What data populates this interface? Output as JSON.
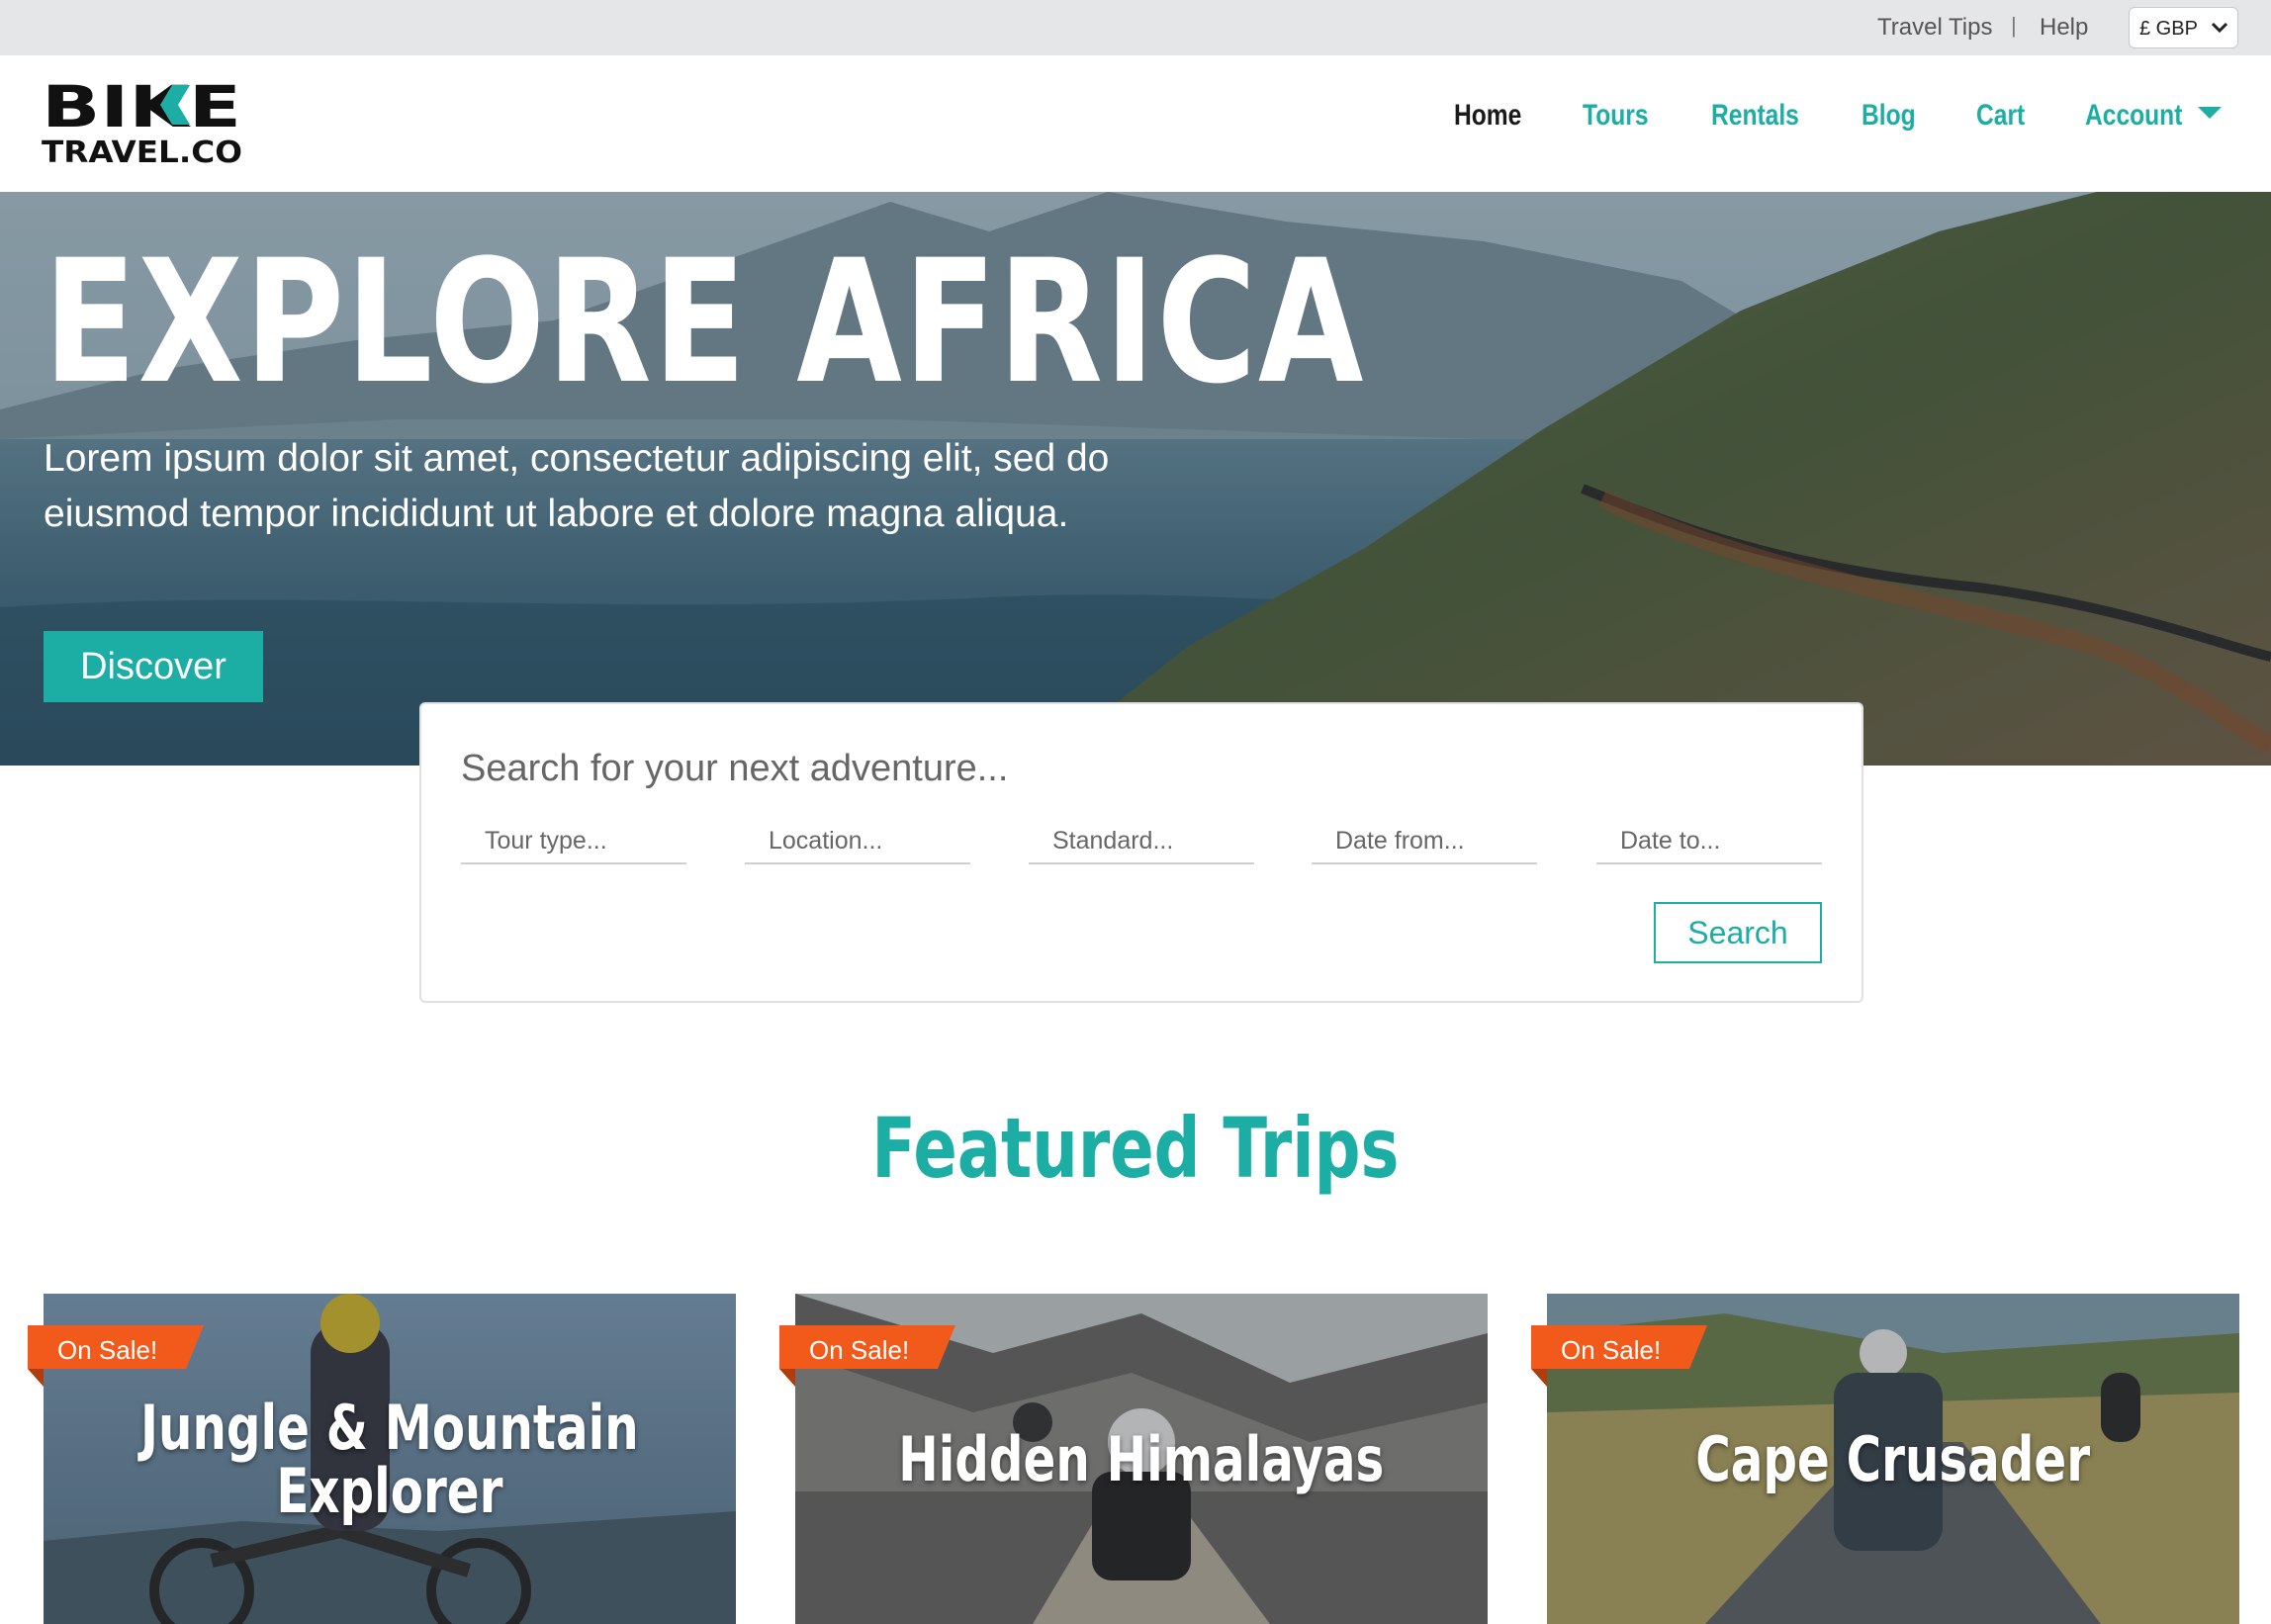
{
  "topbar": {
    "travel_tips": "Travel Tips",
    "separator": "|",
    "help": "Help",
    "currency": "£ GBP",
    "currency_icon": "chevron-down-icon"
  },
  "logo": {
    "line1": "BIKE",
    "line2": "TRAVEL.CO"
  },
  "nav": {
    "items": [
      {
        "label": "Home",
        "active": true
      },
      {
        "label": "Tours",
        "active": false
      },
      {
        "label": "Rentals",
        "active": false
      },
      {
        "label": "Blog",
        "active": false
      },
      {
        "label": "Cart",
        "active": false
      },
      {
        "label": "Account",
        "active": false
      }
    ],
    "account_icon": "caret-down-icon"
  },
  "hero": {
    "title": "EXPLORE AFRICA",
    "text": "Lorem ipsum dolor sit amet, consectetur adipiscing elit, sed do eiusmod tempor incididunt ut labore et dolore magna aliqua.",
    "cta": "Discover"
  },
  "search": {
    "heading": "Search for your next adventure...",
    "fields": [
      {
        "placeholder": "Tour type..."
      },
      {
        "placeholder": "Location..."
      },
      {
        "placeholder": "Standard..."
      },
      {
        "placeholder": "Date from..."
      },
      {
        "placeholder": "Date to..."
      }
    ],
    "button": "Search"
  },
  "featured": {
    "title": "Featured Trips",
    "cards": [
      {
        "title_line1": "Jungle & Mountain",
        "title_line2": "Explorer",
        "badge": "On Sale!"
      },
      {
        "title_line1": "Hidden Himalayas",
        "title_line2": "",
        "badge": "On Sale!"
      },
      {
        "title_line1": "Cape Crusader",
        "title_line2": "",
        "badge": "On Sale!"
      }
    ]
  },
  "colors": {
    "accent": "#1cada4",
    "badge": "#f25a1c",
    "topbar": "#e5e6e8",
    "dark": "#1a1a1a"
  }
}
